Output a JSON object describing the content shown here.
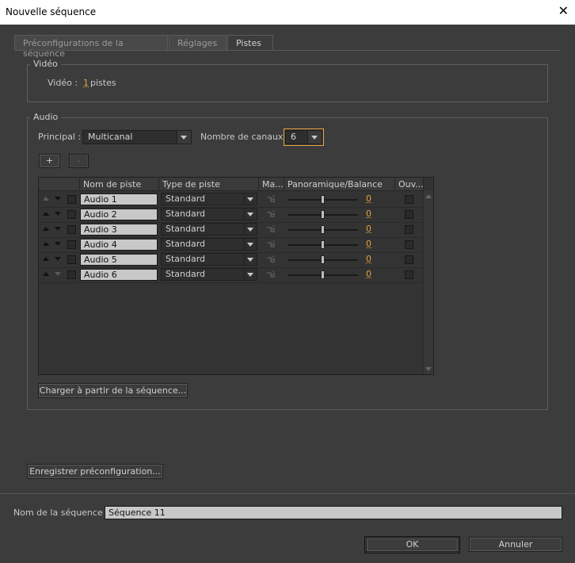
{
  "window": {
    "title": "Nouvelle séquence",
    "close_glyph": "✕"
  },
  "tabs": [
    {
      "label": "Préconfigurations de la séquence"
    },
    {
      "label": "Réglages"
    },
    {
      "label": "Pistes",
      "active": true
    }
  ],
  "video": {
    "group_label": "Vidéo",
    "label": "Vidéo :",
    "count": "1",
    "unit": "pistes"
  },
  "audio": {
    "group_label": "Audio",
    "principal_label": "Principal :",
    "principal_value": "Multicanal",
    "channels_label": "Nombre de canaux :",
    "channels_value": "6",
    "add_label": "+",
    "remove_label": "-",
    "columns": [
      "Nom de piste",
      "Type de piste",
      "Ma...",
      "Panoramique/Balance",
      "Ouv..."
    ],
    "tracks": [
      {
        "name": "Audio 1",
        "type": "Standard",
        "pan": "0"
      },
      {
        "name": "Audio 2",
        "type": "Standard",
        "pan": "0"
      },
      {
        "name": "Audio 3",
        "type": "Standard",
        "pan": "0"
      },
      {
        "name": "Audio 4",
        "type": "Standard",
        "pan": "0"
      },
      {
        "name": "Audio 5",
        "type": "Standard",
        "pan": "0"
      },
      {
        "name": "Audio 6",
        "type": "Standard",
        "pan": "0"
      }
    ],
    "load_button": "Charger à partir de la séquence..."
  },
  "save_preset_button": "Enregistrer préconfiguration...",
  "sequence_name": {
    "label": "Nom de la séquence :",
    "value": "Séquence 11"
  },
  "ok_button": "OK",
  "cancel_button": "Annuler",
  "colors": {
    "accent": "#e8a040",
    "background": "#3c3c3c"
  }
}
